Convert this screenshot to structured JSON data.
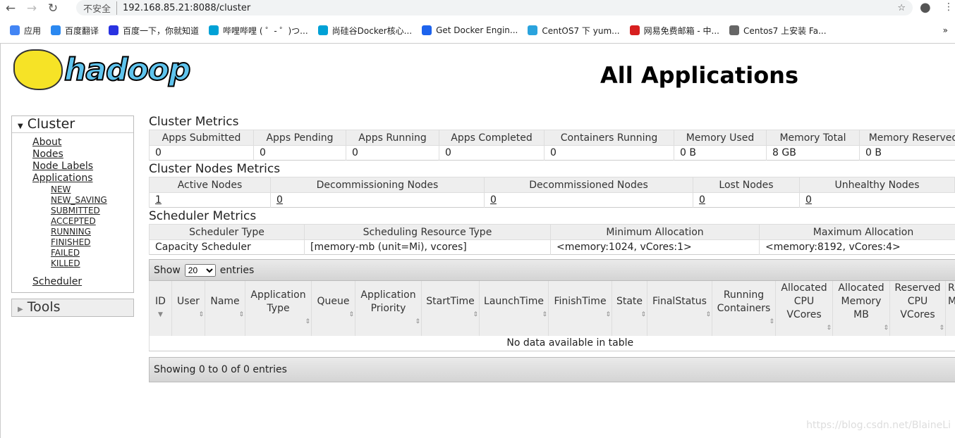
{
  "browser": {
    "security": "不安全",
    "url": "192.168.85.21:8088/cluster",
    "bookmarks": [
      {
        "label": "应用",
        "color": "#4285f4"
      },
      {
        "label": "百度翻译",
        "color": "#2b88f0"
      },
      {
        "label": "百度一下，你就知道",
        "color": "#2932e1"
      },
      {
        "label": "哔哩哔哩 ( ゜- ゜)つ...",
        "color": "#00a1d6"
      },
      {
        "label": "尚硅谷Docker核心...",
        "color": "#00a1d6"
      },
      {
        "label": "Get Docker Engin...",
        "color": "#1d63ed"
      },
      {
        "label": "CentOS7 下 yum...",
        "color": "#2aa3dd"
      },
      {
        "label": "网易免费邮箱 - 中...",
        "color": "#d71f1f"
      },
      {
        "label": "Centos7 上安装 Fa...",
        "color": "#666"
      }
    ]
  },
  "logo": "hadoop",
  "title": "All Applications",
  "sidebar": {
    "cluster": "Cluster",
    "links": [
      "About",
      "Nodes",
      "Node Labels",
      "Applications"
    ],
    "sublinks": [
      "NEW",
      "NEW_SAVING",
      "SUBMITTED",
      "ACCEPTED",
      "RUNNING",
      "FINISHED",
      "FAILED",
      "KILLED"
    ],
    "scheduler": "Scheduler",
    "tools": "Tools"
  },
  "cluster_metrics": {
    "title": "Cluster Metrics",
    "headers": [
      "Apps Submitted",
      "Apps Pending",
      "Apps Running",
      "Apps Completed",
      "Containers Running",
      "Memory Used",
      "Memory Total",
      "Memory Reserved"
    ],
    "values": [
      "0",
      "0",
      "0",
      "0",
      "0",
      "0 B",
      "8 GB",
      "0 B"
    ]
  },
  "node_metrics": {
    "title": "Cluster Nodes Metrics",
    "headers": [
      "Active Nodes",
      "Decommissioning Nodes",
      "Decommissioned Nodes",
      "Lost Nodes",
      "Unhealthy Nodes"
    ],
    "values": [
      "1",
      "0",
      "0",
      "0",
      "0"
    ]
  },
  "scheduler_metrics": {
    "title": "Scheduler Metrics",
    "headers": [
      "Scheduler Type",
      "Scheduling Resource Type",
      "Minimum Allocation",
      "Maximum Allocation"
    ],
    "values": [
      "Capacity Scheduler",
      "[memory-mb (unit=Mi), vcores]",
      "<memory:1024, vCores:1>",
      "<memory:8192, vCores:4>"
    ]
  },
  "apps": {
    "show": "Show",
    "entries": "entries",
    "page_size": "20",
    "headers": [
      "ID",
      "User",
      "Name",
      "Application Type",
      "Queue",
      "Application Priority",
      "StartTime",
      "LaunchTime",
      "FinishTime",
      "State",
      "FinalStatus",
      "Running Containers",
      "Allocated CPU VCores",
      "Allocated Memory MB",
      "Reserved CPU VCores",
      "Reserved Memory MB"
    ],
    "empty": "No data available in table",
    "info": "Showing 0 to 0 of 0 entries"
  },
  "watermark": "https://blog.csdn.net/BlaineLi"
}
